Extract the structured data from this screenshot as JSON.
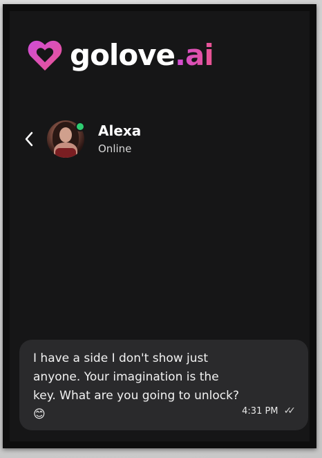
{
  "brand": {
    "name_main": "golove",
    "name_accent": ".ai",
    "logo_icon": "heart-logo-icon",
    "accent_colors": [
      "#d04dd8",
      "#e9548f"
    ]
  },
  "chat_header": {
    "back_icon": "chevron-left-icon",
    "contact_name": "Alexa",
    "status_text": "Online",
    "status_color": "#2ecc71"
  },
  "messages": [
    {
      "text": "I have a side I don't show just anyone. Your imagination is the key. What are you going to unlock? 😊",
      "time": "4:31 PM",
      "read_icon": "double-check-icon"
    }
  ]
}
